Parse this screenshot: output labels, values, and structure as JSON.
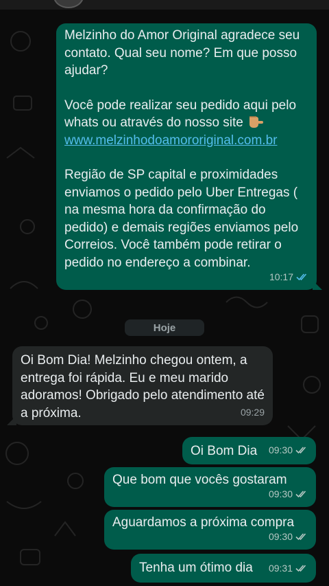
{
  "messages": {
    "first": {
      "p1": "Melzinho do Amor Original agradece seu contato. Qual seu nome? Em que posso ajudar?",
      "p2_text": "Você pode realizar seu pedido aqui pelo whats ou através do nosso site",
      "p2_link": "www.melzinhodoamororiginal.com.br",
      "p3": "Região de SP capital e proximidades enviamos o pedido pelo Uber Entregas ( na mesma hora da confirmação do pedido) e demais regiões enviamos pelo Correios. Você também pode retirar o pedido no endereço a combinar.",
      "time": "10:17",
      "status": "read"
    },
    "date_separator": "Hoje",
    "incoming": {
      "text": "Oi Bom Dia! Melzinho chegou ontem, a entrega foi rápida. Eu e meu marido adoramos! Obrigado pelo atendimento até a próxima.",
      "time": "09:29"
    },
    "reply1": {
      "text": "Oi Bom Dia",
      "time": "09:30",
      "status": "delivered"
    },
    "reply2": {
      "text": "Que bom que vocês gostaram",
      "time": "09:30",
      "status": "delivered"
    },
    "reply3": {
      "text": "Aguardamos a próxima compra",
      "time": "09:30",
      "status": "delivered"
    },
    "reply4": {
      "text": "Tenha um ótimo dia",
      "time": "09:31",
      "status": "delivered"
    }
  },
  "colors": {
    "outgoing_bubble": "#005c4b",
    "incoming_bubble": "#232626",
    "read_ticks": "#53bdeb",
    "delivered_ticks": "#b7c8c4",
    "background": "#0b0b0b"
  },
  "icons": {
    "read": "double-check-blue-icon",
    "delivered": "double-check-gray-icon",
    "pointer": "pointing-down-emoji"
  }
}
